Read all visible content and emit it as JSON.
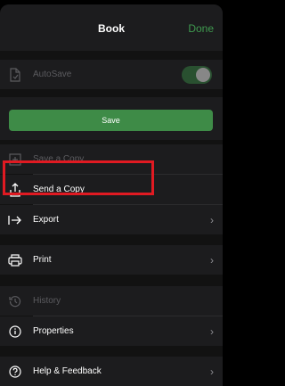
{
  "header": {
    "title": "Book",
    "done_label": "Done"
  },
  "autosave": {
    "label": "AutoSave",
    "enabled": true
  },
  "save_button": {
    "label": "Save"
  },
  "menu": {
    "save_copy": "Save a Copy",
    "send_copy": "Send a Copy",
    "export": "Export",
    "print": "Print",
    "history": "History",
    "properties": "Properties",
    "help": "Help & Feedback"
  },
  "colors": {
    "accent": "#3e8b47",
    "done": "#3f9a4f",
    "highlight": "#e01a22"
  }
}
